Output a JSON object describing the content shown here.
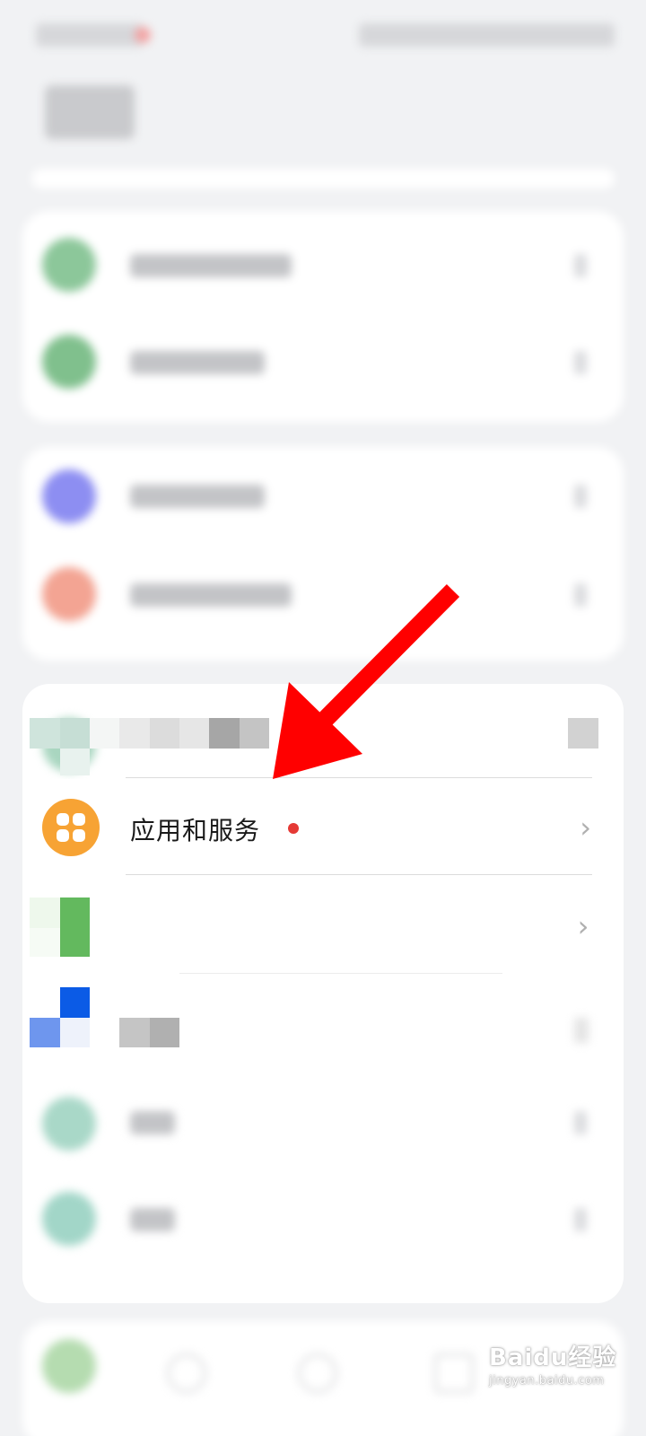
{
  "focused_row": {
    "label": "应用和服务",
    "chevron": "›",
    "has_badge": true,
    "icon": "apps-grid-icon"
  },
  "watermark": {
    "main": "Baidu经验",
    "sub": "jingyan.baidu.com"
  },
  "colors": {
    "app_icon": "#f7a334",
    "badge": "#e53935",
    "arrow": "#ff0000",
    "background": "#f1f2f4"
  }
}
